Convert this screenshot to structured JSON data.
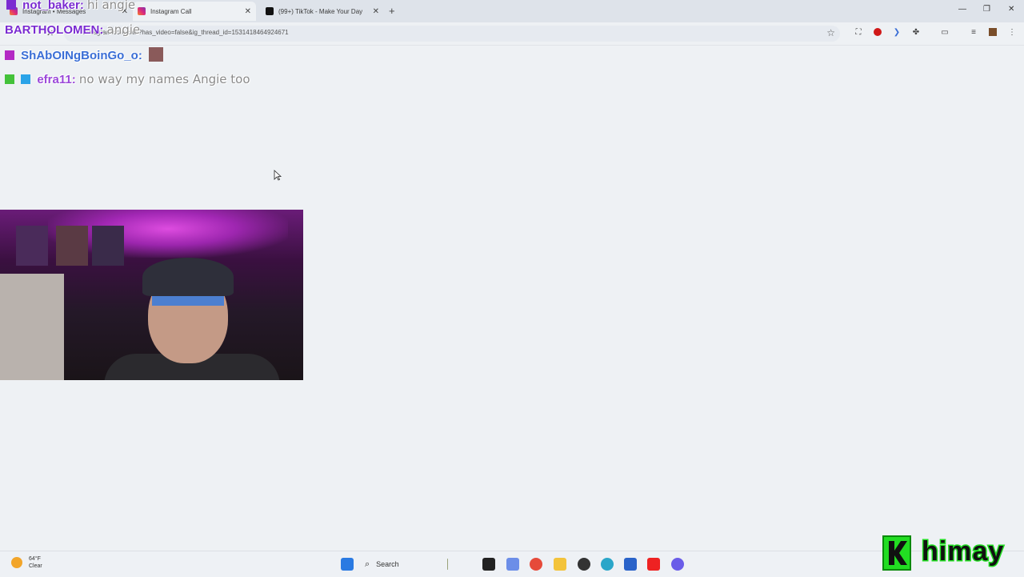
{
  "tabs": [
    {
      "label": "Instagram • Messages",
      "active": false
    },
    {
      "label": "Instagram Call",
      "active": true
    },
    {
      "label": "(99+) TikTok - Make Your Day",
      "active": false
    }
  ],
  "address_bar": {
    "url": "instagram.com/call/?has_video=false&ig_thread_id=1531418464924671"
  },
  "chat": [
    {
      "username": "not_baker:",
      "message": "hi angie"
    },
    {
      "username": "BARTHOLOMEN:",
      "message": "angie"
    },
    {
      "username": "ShAbOINgBoinGo_o:",
      "message": ""
    },
    {
      "username": "efra11:",
      "message": "no way my names Angie too"
    }
  ],
  "taskbar": {
    "weather_temp": "64°F",
    "weather_cond": "Clear",
    "search_label": "Search"
  },
  "logo_text": "himay",
  "colors": {
    "accent": "#7a2bd1",
    "logo_green": "#22dd22"
  }
}
